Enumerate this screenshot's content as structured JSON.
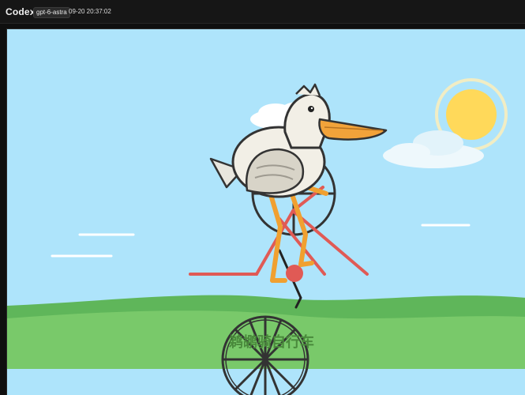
{
  "app": {
    "title": "Codex",
    "model": "gpt-6-astra",
    "timestamp": "09-20 20:37:02"
  },
  "scene": {
    "caption": "鹈鹕骑自行车"
  },
  "colors": {
    "sky": "#aee4fb",
    "hill_back": "#6cc366",
    "hill_front": "#79c96a",
    "sun": "#ffd95a",
    "sun_ring": "#f1edc4",
    "beak": "#f2a33a",
    "frame": "#e05a55",
    "legs": "#f0a030",
    "outline": "#333333",
    "body": "#f2efe6"
  }
}
